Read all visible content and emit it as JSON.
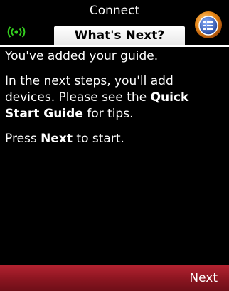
{
  "header": {
    "title": "Connect",
    "tab_label": "What's Next?",
    "signal_icon": "wireless-signal-icon",
    "menu_icon": "menu-list-icon"
  },
  "content": {
    "line1": "You've added your guide.",
    "p2_part1": "In the next steps, you'll add devices. Please see the ",
    "p2_bold": "Quick Start Guide",
    "p2_part2": " for tips.",
    "p3_part1": "Press ",
    "p3_bold": "Next",
    "p3_part2": " to start."
  },
  "softkeys": {
    "right_label": "Next"
  },
  "colors": {
    "softkey_bar": "#8a1520",
    "signal_green": "#35d11f",
    "menu_orange": "#e8891a",
    "menu_blue": "#2f5fb8"
  }
}
